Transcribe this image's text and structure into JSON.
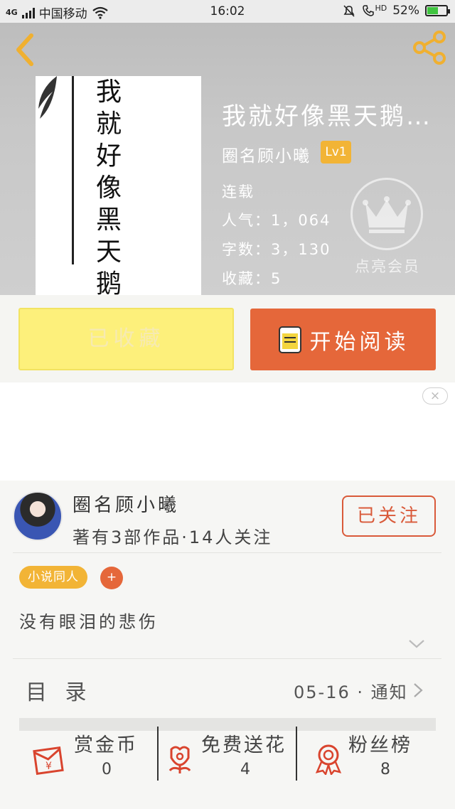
{
  "status_bar": {
    "network": "4G",
    "carrier": "中国移动",
    "time": "16:02",
    "hd": "HD",
    "battery": "52%",
    "battery_level": 0.52
  },
  "book": {
    "cover_title": "我就好像黑天鹅",
    "title": "我就好像黑天鹅…",
    "author": "圈名顾小曦",
    "level": "Lv1",
    "status": "连载",
    "popularity": "人气：1，064",
    "word_count": "字数：3，130",
    "favorites": "收藏：5",
    "vip_label": "点亮会员"
  },
  "actions": {
    "collected_label": "已收藏",
    "read_label": "开始阅读"
  },
  "ad": {
    "close_label": "×"
  },
  "author_card": {
    "name": "圈名顾小曦",
    "info": "著有3部作品·14人关注",
    "follow_label": "已关注"
  },
  "tags": {
    "items": [
      "小说同人"
    ],
    "add_label": "+"
  },
  "intro": "没有眼泪的悲伤",
  "toc": {
    "label": "目 录",
    "update": "05-16 · 通知"
  },
  "bottom_bar": [
    {
      "label": "赏金币",
      "count": "0",
      "icon": "red-envelope-icon"
    },
    {
      "label": "免费送花",
      "count": "4",
      "icon": "flower-icon"
    },
    {
      "label": "粉丝榜",
      "count": "8",
      "icon": "medal-icon"
    }
  ],
  "colors": {
    "accent_orange": "#e5673a",
    "accent_yellow": "#f2b436",
    "collected_bg": "#fdf07b"
  }
}
